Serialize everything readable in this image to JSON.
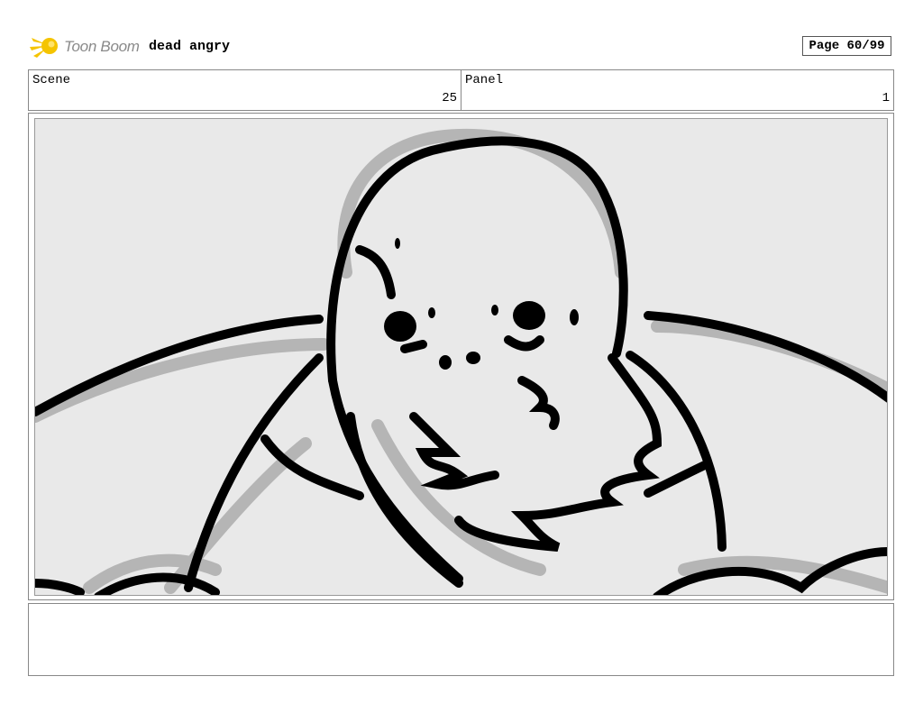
{
  "header": {
    "logo_text": "Toon Boom",
    "project_title": "dead angry",
    "page_label": "Page 60/99"
  },
  "scene": {
    "label": "Scene",
    "value": "25"
  },
  "panel": {
    "label": "Panel",
    "value": "1"
  },
  "notes": {
    "text": ""
  },
  "colors": {
    "logo_accent": "#f5c400",
    "sketch_black": "#000000",
    "sketch_grey": "#b5b5b5",
    "panel_bg": "#e9e9e9"
  }
}
